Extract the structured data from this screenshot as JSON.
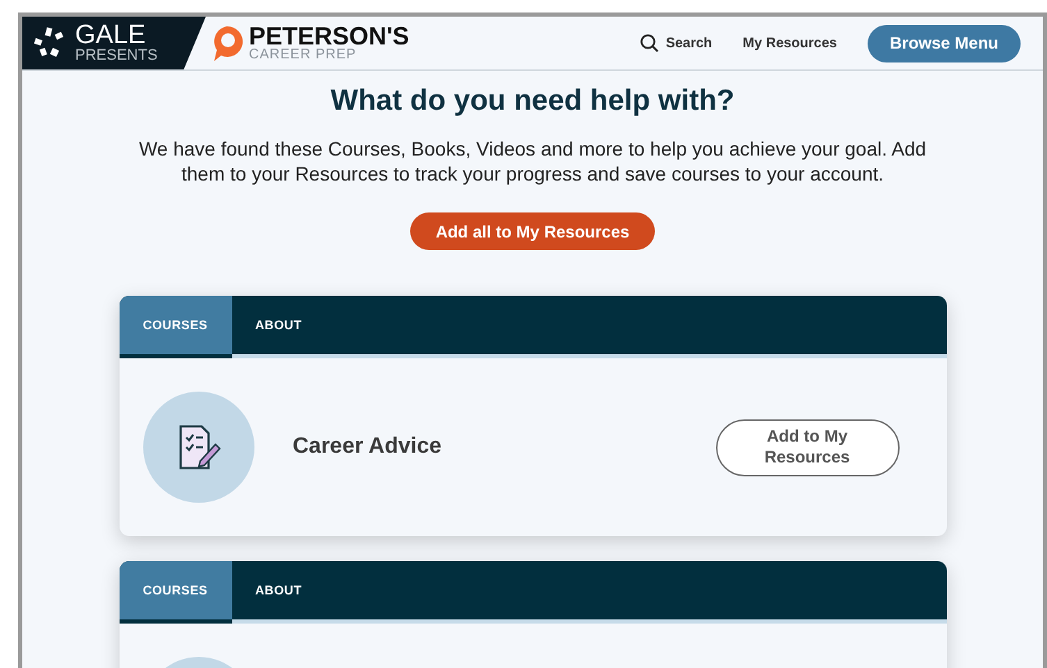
{
  "header": {
    "brand": {
      "gale_name": "GALE",
      "gale_sub": "PRESENTS",
      "name": "PETERSON'S",
      "sub": "CAREER PREP"
    },
    "nav": [
      {
        "kind": "search",
        "label": "Search"
      },
      {
        "kind": "link",
        "label": "My Resources"
      },
      {
        "kind": "button",
        "label": "Browse Menu"
      }
    ]
  },
  "heading": "What do you need help with?",
  "intro": "We have found these Courses, Books, Videos and more to help you achieve your goal. Add them to your Resources to track your progress and save courses to your account.",
  "add_all_button": "Add all to My Resources",
  "cards": [
    {
      "tabs": [
        {
          "label": "COURSES",
          "selected": true
        },
        {
          "label": "ABOUT",
          "selected": false
        }
      ],
      "title": "Career Advice",
      "button": "Add to My Resources"
    },
    {
      "tabs": [
        {
          "label": "COURSES",
          "selected": true
        },
        {
          "label": "ABOUT",
          "selected": false
        }
      ]
    }
  ]
}
